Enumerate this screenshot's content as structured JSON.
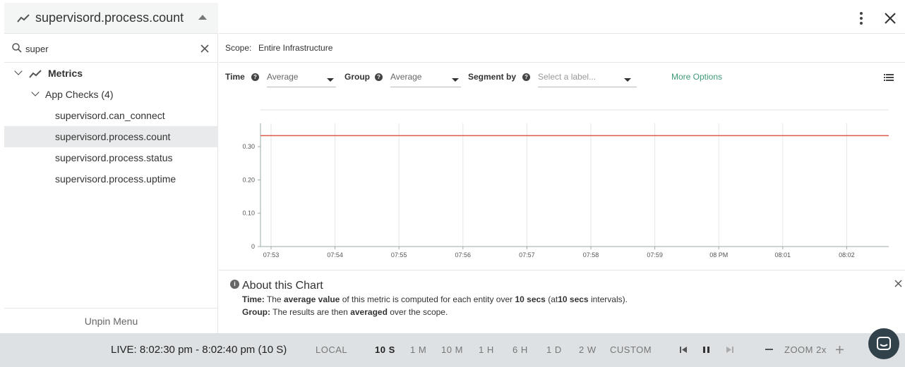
{
  "panel": {
    "title": "supervisord.process.count",
    "search_value": "super",
    "tree": {
      "root_label": "Metrics",
      "group_label": "App Checks (4)",
      "items": [
        "supervisord.can_connect",
        "supervisord.process.count",
        "supervisord.process.status",
        "supervisord.process.uptime"
      ],
      "selected_index": 1
    },
    "unpin_label": "Unpin Menu"
  },
  "scope": {
    "label": "Scope:",
    "value": "Entire Infrastructure"
  },
  "controls": {
    "time_label": "Time",
    "time_value": "Average",
    "group_label": "Group",
    "group_value": "Average",
    "segment_label": "Segment by",
    "segment_placeholder": "Select a label...",
    "more_options": "More Options"
  },
  "colors": {
    "accent": "#3e9a76",
    "series": "#e05a4a",
    "bottom_bar": "#dde1e3"
  },
  "chart_data": {
    "type": "line",
    "x": [
      "07:53",
      "07:54",
      "07:55",
      "07:56",
      "07:57",
      "07:58",
      "07:59",
      "08 PM",
      "08:01",
      "08:02"
    ],
    "series": [
      {
        "values": [
          0.333,
          0.333,
          0.333,
          0.333,
          0.333,
          0.333,
          0.333,
          0.333,
          0.333,
          0.333
        ]
      }
    ],
    "yticks": [
      "0",
      "0.10",
      "0.20",
      "0.30"
    ],
    "ylim": [
      0,
      0.37
    ],
    "grid": "vertical"
  },
  "about": {
    "title": "About this Chart",
    "time_label": "Time:",
    "time_text_1": "The",
    "time_bold_1": "average value",
    "time_text_2": "of this metric is computed for each entity over",
    "time_bold_2": "10 secs",
    "time_text_3": "(at",
    "time_bold_3": "10 secs",
    "time_text_4": "intervals).",
    "group_label": "Group:",
    "group_text_1": "The results are then",
    "group_bold": "averaged",
    "group_text_2": "over the scope."
  },
  "bottom_bar": {
    "live": "LIVE: 8:02:30 pm - 8:02:40 pm (10 S)",
    "timezone": "LOCAL",
    "ranges": [
      "10 S",
      "1 M",
      "10 M",
      "1 H",
      "6 H",
      "1 D",
      "2 W",
      "CUSTOM"
    ],
    "active_range": "10 S",
    "zoom": "ZOOM 2x"
  }
}
